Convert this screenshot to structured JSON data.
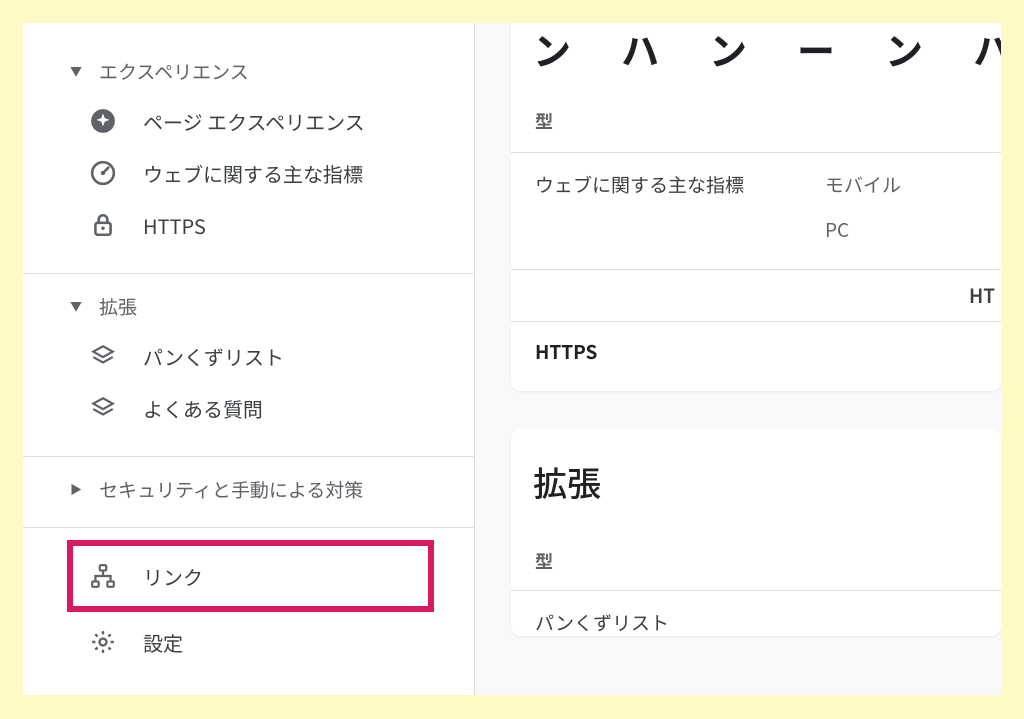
{
  "sidebar": {
    "sections": [
      {
        "id": "experience",
        "label": "エクスペリエンス",
        "expanded": true,
        "items": [
          {
            "id": "page-experience",
            "label": "ページ エクスペリエンス",
            "icon": "sparkle"
          },
          {
            "id": "core-web-vitals",
            "label": "ウェブに関する主な指標",
            "icon": "gauge"
          },
          {
            "id": "https",
            "label": "HTTPS",
            "icon": "lock"
          }
        ]
      },
      {
        "id": "enhancements",
        "label": "拡張",
        "expanded": true,
        "items": [
          {
            "id": "breadcrumbs",
            "label": "パンくずリスト",
            "icon": "layers"
          },
          {
            "id": "faq",
            "label": "よくある質問",
            "icon": "layers"
          }
        ]
      },
      {
        "id": "security-manual-actions",
        "label": "セキュリティと手動による対策",
        "expanded": false,
        "items": []
      }
    ],
    "bottom": [
      {
        "id": "links",
        "label": "リンク",
        "icon": "sitemap",
        "highlighted": true
      },
      {
        "id": "settings",
        "label": "設定",
        "icon": "gear"
      }
    ]
  },
  "main": {
    "card1": {
      "truncated_title": "ン　ハ　ン　ー　ン　ハ",
      "type_label": "型",
      "row1_col1": "ウェブに関する主な指標",
      "row1_col2": "モバイル",
      "row2_col2": "PC",
      "right_trunc": "HT",
      "https": "HTTPS"
    },
    "card2": {
      "title": "拡張",
      "type_label": "型",
      "row1": "パンくずリスト"
    }
  }
}
